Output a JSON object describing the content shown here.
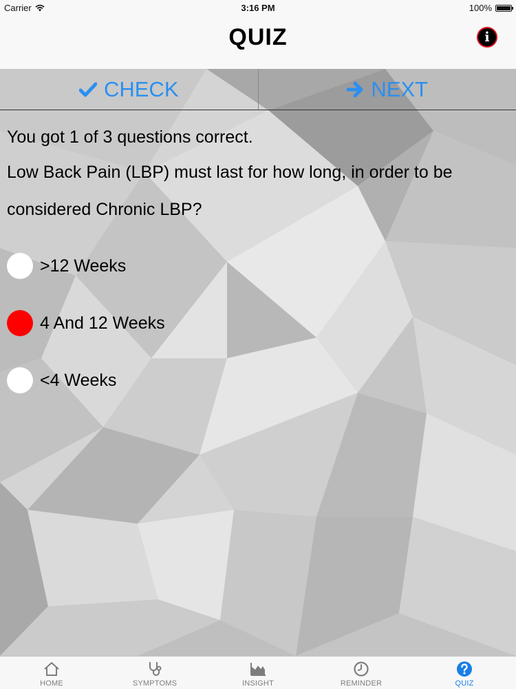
{
  "status_bar": {
    "carrier": "Carrier",
    "time": "3:16 PM",
    "battery": "100%"
  },
  "nav": {
    "title": "QUIZ",
    "info_icon": "info-icon"
  },
  "toolbar": {
    "check_label": "CHECK",
    "check_icon": "checkmark-icon",
    "next_label": "NEXT",
    "next_icon": "arrow-right-icon",
    "accent_color": "#2b8ff0"
  },
  "quiz": {
    "score_text": "You got 1 of 3 questions correct.",
    "question": "Low Back Pain (LBP) must last for how long, in order to be considered Chronic LBP?",
    "options": [
      {
        "label": ">12 Weeks",
        "selected": false
      },
      {
        "label": "4 And 12 Weeks",
        "selected": true
      },
      {
        "label": "<4 Weeks",
        "selected": false
      }
    ],
    "selected_color": "#ff0000"
  },
  "tabs": [
    {
      "label": "HOME",
      "icon": "home-icon",
      "active": false
    },
    {
      "label": "SYMPTOMS",
      "icon": "stethoscope-icon",
      "active": false
    },
    {
      "label": "INSIGHT",
      "icon": "area-chart-icon",
      "active": false
    },
    {
      "label": "REMINDER",
      "icon": "clock-icon",
      "active": false
    },
    {
      "label": "QUIZ",
      "icon": "question-icon",
      "active": true
    }
  ],
  "colors": {
    "tab_active": "#1a7ee6",
    "tab_inactive": "#7d7d7d"
  }
}
